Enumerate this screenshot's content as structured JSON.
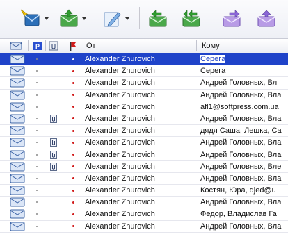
{
  "columns": {
    "from": "От",
    "to": "Кому"
  },
  "icons": {
    "toolbar": [
      "new-mail-icon",
      "receive-mail-icon",
      "compose-icon",
      "reply-icon",
      "reply-all-icon",
      "forward-icon",
      "mail-out-icon"
    ],
    "header": [
      "envelope-col-icon",
      "priority-col-icon",
      "attachment-col-icon",
      "flag-col-icon"
    ]
  },
  "colors": {
    "selection": "#1f43c9",
    "flag": "#d11a1a",
    "priority_badge": "#2a4fd0"
  },
  "messages": [
    {
      "from": "Alexander Zhurovich",
      "to": "Серега",
      "attach": false,
      "selected": true
    },
    {
      "from": "Alexander Zhurovich",
      "to": "Серега",
      "attach": false,
      "selected": false
    },
    {
      "from": "Alexander Zhurovich",
      "to": "Андрей Головных, Вл",
      "attach": false,
      "selected": false
    },
    {
      "from": "Alexander Zhurovich",
      "to": "Андрей Головных, Вла",
      "attach": false,
      "selected": false
    },
    {
      "from": "Alexander Zhurovich",
      "to": "afl1@softpress.com.ua",
      "attach": false,
      "selected": false
    },
    {
      "from": "Alexander Zhurovich",
      "to": "Андрей Головных, Вла",
      "attach": true,
      "selected": false
    },
    {
      "from": "Alexander Zhurovich",
      "to": "дядя Саша, Лешка, Са",
      "attach": false,
      "selected": false
    },
    {
      "from": "Alexander Zhurovich",
      "to": "Андрей Головных, Вла",
      "attach": true,
      "selected": false
    },
    {
      "from": "Alexander Zhurovich",
      "to": "Андрей Головных, Вла",
      "attach": true,
      "selected": false
    },
    {
      "from": "Alexander Zhurovich",
      "to": "Андрей Головных, Вле",
      "attach": true,
      "selected": false
    },
    {
      "from": "Alexander Zhurovich",
      "to": "Андрей Головных, Вла",
      "attach": false,
      "selected": false
    },
    {
      "from": "Alexander Zhurovich",
      "to": "Костян, Юра, djed@u",
      "attach": false,
      "selected": false
    },
    {
      "from": "Alexander Zhurovich",
      "to": "Андрей Головных, Вла",
      "attach": false,
      "selected": false
    },
    {
      "from": "Alexander Zhurovich",
      "to": "Федор, Владислав Га",
      "attach": false,
      "selected": false
    },
    {
      "from": "Alexander Zhurovich",
      "to": "Андрей Головных, Вла",
      "attach": false,
      "selected": false
    }
  ]
}
